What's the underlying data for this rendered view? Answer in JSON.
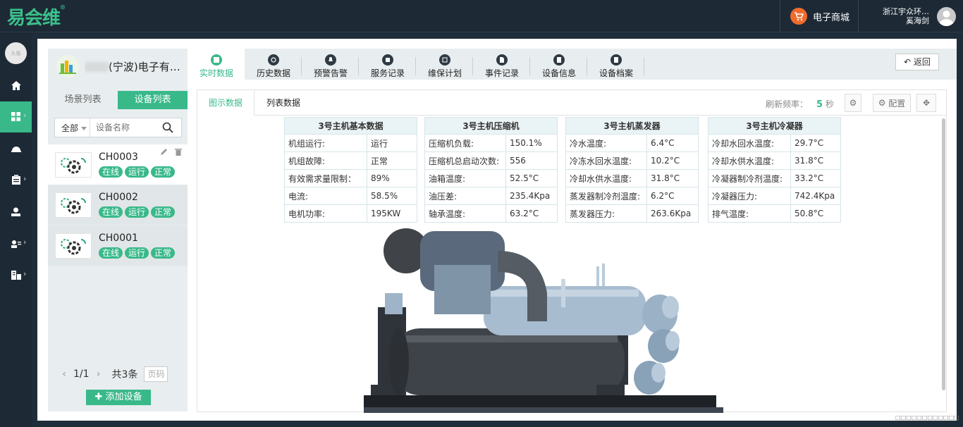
{
  "header": {
    "logo": "易会维",
    "logo_mark": "®",
    "shop_label": "电子商城",
    "user_company": "浙江宇众环…",
    "user_name": "奚海剑"
  },
  "leftnav": {
    "avatar_text": "头像"
  },
  "device_panel": {
    "company_suffix": "(宁波)电子有…",
    "tabs": [
      "场景列表",
      "设备列表"
    ],
    "filter_selected": "全部",
    "search_placeholder": "设备名称",
    "devices": [
      {
        "code": "CH0003",
        "badges": [
          "在线",
          "运行",
          "正常"
        ]
      },
      {
        "code": "CH0002",
        "badges": [
          "在线",
          "运行",
          "正常"
        ]
      },
      {
        "code": "CH0001",
        "badges": [
          "在线",
          "运行",
          "正常"
        ]
      }
    ],
    "pager": {
      "page": "1/1",
      "total": "共3条",
      "page_input_placeholder": "页码"
    },
    "add_button": "添加设备"
  },
  "top_tabs": [
    "实时数据",
    "历史数据",
    "预警告警",
    "服务记录",
    "维保计划",
    "事件记录",
    "设备信息",
    "设备档案"
  ],
  "back_button": "返回",
  "content_tabs": [
    "图示数据",
    "列表数据"
  ],
  "refresh": {
    "label": "刷新频率：",
    "value": "5",
    "unit": "秒"
  },
  "config_button": "配置",
  "tables": [
    {
      "title": "3号主机基本数据",
      "rows": [
        [
          "机组运行:",
          "运行"
        ],
        [
          "机组故障:",
          "正常"
        ],
        [
          "有效需求量限制：",
          "89%"
        ],
        [
          "电流:",
          "58.5%"
        ],
        [
          "电机功率:",
          "195KW"
        ]
      ]
    },
    {
      "title": "3号主机压缩机",
      "rows": [
        [
          "压缩机负载:",
          "150.1%"
        ],
        [
          "压缩机总启动次数:",
          "556"
        ],
        [
          "油箱温度:",
          "52.5°C"
        ],
        [
          "油压差:",
          "235.4Kpa"
        ],
        [
          "轴承温度:",
          "63.2°C"
        ]
      ]
    },
    {
      "title": "3号主机蒸发器",
      "rows": [
        [
          "冷水温度:",
          "6.4°C"
        ],
        [
          "冷冻水回水温度:",
          "10.2°C"
        ],
        [
          "冷却水供水温度:",
          "31.8°C"
        ],
        [
          "蒸发器制冷剂温度:",
          "6.2°C"
        ],
        [
          "蒸发器压力:",
          "263.6Kpa"
        ]
      ]
    },
    {
      "title": "3号主机冷凝器",
      "rows": [
        [
          "冷却水回水温度:",
          "29.7°C"
        ],
        [
          "冷却水供水温度:",
          "31.8°C"
        ],
        [
          "冷凝器制冷剂温度:",
          "33.2°C"
        ],
        [
          "冷凝器压力:",
          "742.4Kpa"
        ],
        [
          "排气温度:",
          "50.8°C"
        ]
      ]
    }
  ],
  "footer_corner": "□□□□□□□□□□□□"
}
